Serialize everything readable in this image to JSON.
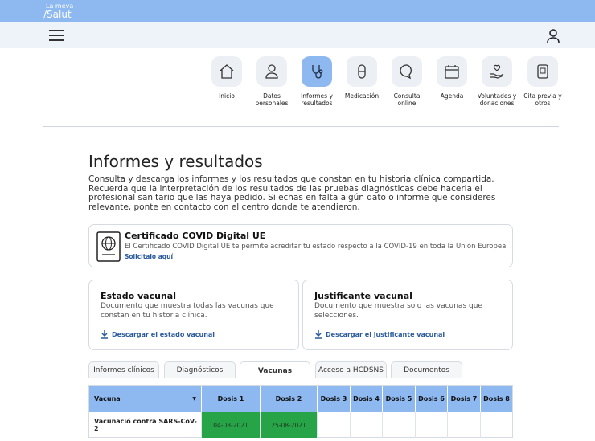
{
  "header": {
    "logo_line1": "La meva",
    "logo_line2": "/Salut"
  },
  "nav": {
    "menu_icon": "hamburger-icon",
    "user_icon": "user-icon",
    "items": [
      {
        "label": "Inicio",
        "icon": "home-icon"
      },
      {
        "label": "Datos personales",
        "icon": "person-icon"
      },
      {
        "label": "Informes y resultados",
        "icon": "stethoscope-icon",
        "active": true
      },
      {
        "label": "Medicación",
        "icon": "pill-icon"
      },
      {
        "label": "Consulta online",
        "icon": "chat-icon"
      },
      {
        "label": "Agenda",
        "icon": "calendar-icon"
      },
      {
        "label": "Voluntades y donaciones",
        "icon": "hand-heart-icon"
      },
      {
        "label": "Cita previa y otros",
        "icon": "tablet-icon"
      }
    ]
  },
  "page": {
    "title": "Informes y resultados",
    "intro": "Consulta y descarga los informes y los resultados que constan en tu historia clínica compartida. Recuerda que la interpretación de los resultados de las pruebas diagnósticas debe hacerla el profesional sanitario que las haya pedido. Si echas en falta algún dato o informe que consideres relevante, ponte en contacto con el centro donde te atendieron."
  },
  "covid_card": {
    "title": "Certificado COVID Digital UE",
    "description": "El Certificado COVID Digital UE te permite acreditar tu estado respecto a la COVID-19 en toda la Unión Europea.",
    "link": "Solicitalo aquí",
    "icon": "passport-icon"
  },
  "vaccine_cards": [
    {
      "title": "Estado vacunal",
      "description": "Documento que muestra todas las vacunas que constan en tu historia clínica.",
      "link": "Descargar el estado vacunal"
    },
    {
      "title": "Justificante vacunal",
      "description": "Documento que muestra solo las vacunas que selecciones.",
      "link": "Descargar el justificante vacunal"
    }
  ],
  "tabs": [
    {
      "label": "Informes clínicos"
    },
    {
      "label": "Diagnósticos"
    },
    {
      "label": "Vacunas",
      "active": true
    },
    {
      "label": "Acceso a HCDSNS"
    },
    {
      "label": "Documentos"
    }
  ],
  "table": {
    "headers": [
      "Vacuna",
      "Dosis 1",
      "Dosis 2",
      "Dosis 3",
      "Dosis 4",
      "Dosis 5",
      "Dosis 6",
      "Dosis 7",
      "Dosis 8"
    ],
    "rows": [
      [
        "Vacunació contra SARS-CoV-2",
        "04-08-2021",
        "25-08-2021",
        "",
        "",
        "",
        "",
        "",
        ""
      ]
    ]
  },
  "colors": {
    "accent": "#8db8f0",
    "dose_done": "#27a348",
    "link": "#2a5a9c"
  }
}
